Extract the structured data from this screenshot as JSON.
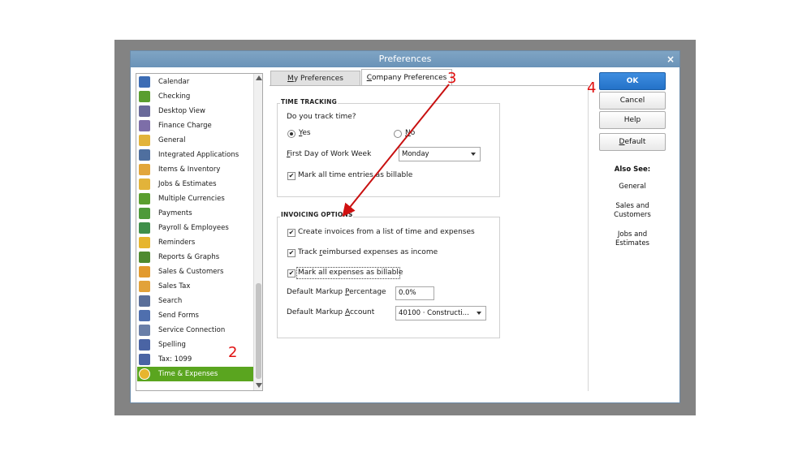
{
  "window": {
    "title": "Preferences",
    "close_glyph": "×"
  },
  "categories": [
    {
      "label": "Calendar",
      "icon": "calendar-icon",
      "color": "#3d6db5"
    },
    {
      "label": "Checking",
      "icon": "checking-icon",
      "color": "#5a9e2f"
    },
    {
      "label": "Desktop View",
      "icon": "desktop-view-icon",
      "color": "#6a6a9a"
    },
    {
      "label": "Finance Charge",
      "icon": "finance-charge-icon",
      "color": "#7d6ea8"
    },
    {
      "label": "General",
      "icon": "general-icon",
      "color": "#e2b33a"
    },
    {
      "label": "Integrated Applications",
      "icon": "integrated-applications-icon",
      "color": "#4f6f9f"
    },
    {
      "label": "Items & Inventory",
      "icon": "items-inventory-icon",
      "color": "#e2a63a"
    },
    {
      "label": "Jobs & Estimates",
      "icon": "jobs-estimates-icon",
      "color": "#e2b33a"
    },
    {
      "label": "Multiple Currencies",
      "icon": "multiple-currencies-icon",
      "color": "#5a9e2f"
    },
    {
      "label": "Payments",
      "icon": "payments-icon",
      "color": "#4e9a3a"
    },
    {
      "label": "Payroll & Employees",
      "icon": "payroll-employees-icon",
      "color": "#3f8f4a"
    },
    {
      "label": "Reminders",
      "icon": "reminders-icon",
      "color": "#e6b52e"
    },
    {
      "label": "Reports & Graphs",
      "icon": "reports-graphs-icon",
      "color": "#4e8a2f"
    },
    {
      "label": "Sales & Customers",
      "icon": "sales-customers-icon",
      "color": "#e29a2e"
    },
    {
      "label": "Sales Tax",
      "icon": "sales-tax-icon",
      "color": "#e2a23a"
    },
    {
      "label": "Search",
      "icon": "search-icon",
      "color": "#5a6f9a"
    },
    {
      "label": "Send Forms",
      "icon": "send-forms-icon",
      "color": "#4f6fae"
    },
    {
      "label": "Service Connection",
      "icon": "service-connection-icon",
      "color": "#6a7fa8"
    },
    {
      "label": "Spelling",
      "icon": "spelling-icon",
      "color": "#4a64a4"
    },
    {
      "label": "Tax: 1099",
      "icon": "tax-1099-icon",
      "color": "#4a64a4"
    },
    {
      "label": "Time & Expenses",
      "icon": "time-expenses-icon",
      "color": "#e6b52e",
      "selected": true
    }
  ],
  "tabs": {
    "my_prefix": "",
    "my_underline": "M",
    "my_rest": "y Preferences",
    "company_underline": "C",
    "company_rest": "ompany Preferences"
  },
  "time_tracking": {
    "title": "TIME TRACKING",
    "question": "Do you track time?",
    "yes_u": "Y",
    "yes_rest": "es",
    "no_u": "N",
    "no_rest": "o",
    "first_day_u": "F",
    "first_day_rest": "irst Day of Work Week",
    "first_day_value": "Monday",
    "mark_billable": "Mark all time entries as billable"
  },
  "invoicing_options": {
    "title": "INVOICING OPTIONS",
    "create_invoices": "Create invoices from a list of time and expenses",
    "track_prefix": "Track ",
    "track_u": "r",
    "track_rest": "eimbursed expenses as income",
    "mark_expenses": "Mark all expenses as billable",
    "markup_pct_prefix": "Default Markup ",
    "markup_pct_u": "P",
    "markup_pct_rest": "ercentage",
    "markup_pct_value": "0.0%",
    "markup_acct_prefix": "Default Markup ",
    "markup_acct_u": "A",
    "markup_acct_rest": "ccount",
    "markup_acct_value": "40100 · Constructi..."
  },
  "buttons": {
    "ok": "OK",
    "cancel": "Cancel",
    "help": "Help",
    "default_u": "D",
    "default_rest": "efault"
  },
  "also_see": {
    "title": "Also See:",
    "items": [
      "General",
      "Sales and\nCustomers",
      "Jobs and\nEstimates"
    ]
  },
  "annotations": {
    "a2": "2",
    "a3": "3",
    "a4": "4",
    "color": "#e01010"
  }
}
